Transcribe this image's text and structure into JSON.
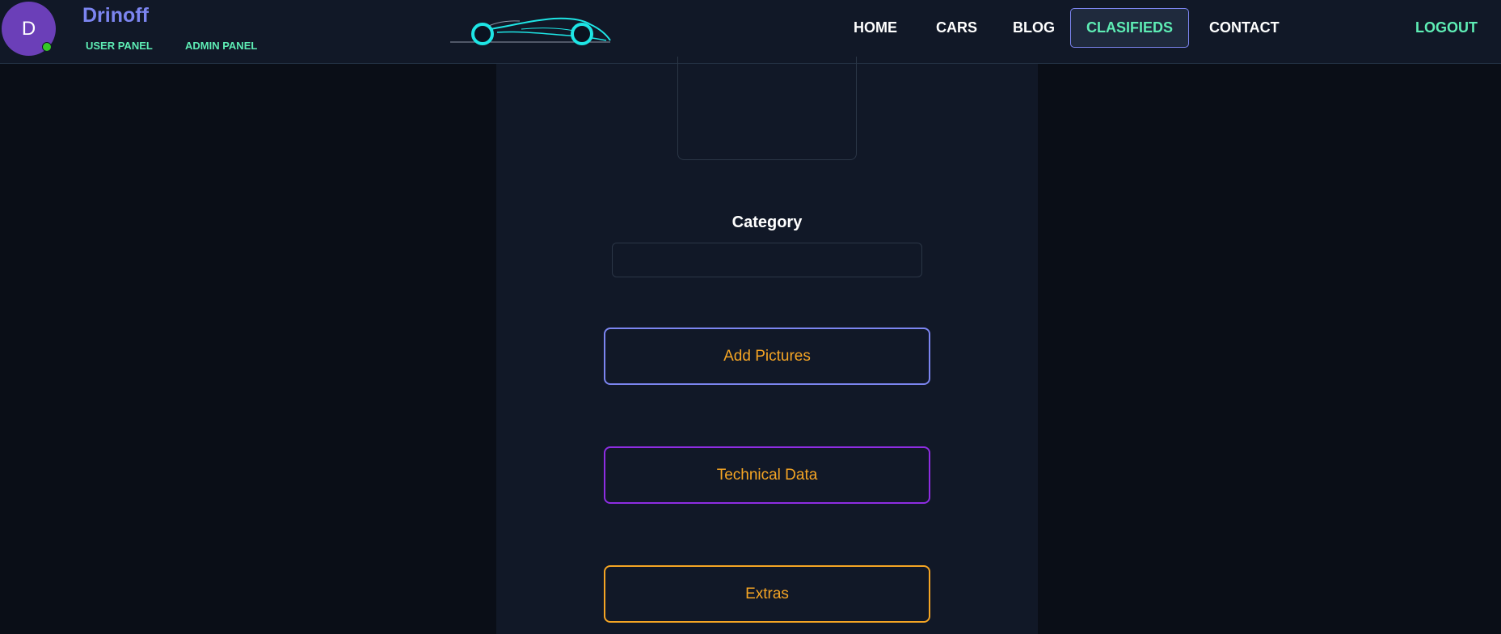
{
  "user": {
    "avatar_letter": "D",
    "name": "Drinoff",
    "status_color": "#35c826"
  },
  "header": {
    "user_panel_label": "USER PANEL",
    "admin_panel_label": "ADMIN PANEL",
    "logo_icon": "car-silhouette-icon"
  },
  "nav": {
    "home": "HOME",
    "cars": "CARS",
    "blog": "BLOG",
    "classifieds": "CLASIFIEDS",
    "contact": "CONTACT",
    "logout": "LOGOUT",
    "active_item": "CLASIFIEDS"
  },
  "form": {
    "category_label": "Category",
    "category_value": "",
    "add_pictures_label": "Add Pictures",
    "technical_data_label": "Technical Data",
    "extras_label": "Extras"
  },
  "colors": {
    "accent_blue": "#7c85f0",
    "accent_teal": "#5eedb5",
    "accent_purple": "#8e2de2",
    "accent_orange": "#f5a524",
    "logo_cyan": "#1ee5e5"
  }
}
